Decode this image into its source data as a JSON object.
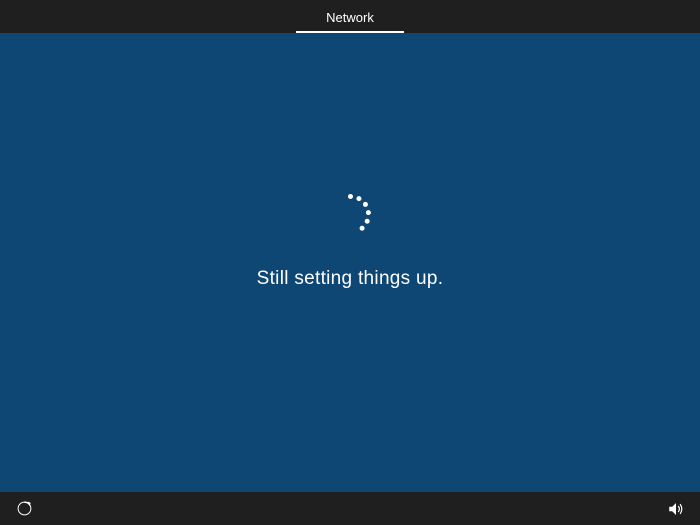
{
  "header": {
    "tab_label": "Network"
  },
  "main": {
    "status_text": "Still setting things up."
  },
  "spinner": {
    "dot_count": 6,
    "radius": 18,
    "start_angle": -90,
    "angle_step": 28
  },
  "footer": {
    "left_icon": "ease-of-access-icon",
    "right_icon": "volume-icon"
  },
  "colors": {
    "topbar_bg": "#1f1f1f",
    "content_bg": "#0e4674",
    "text": "#ffffff"
  }
}
